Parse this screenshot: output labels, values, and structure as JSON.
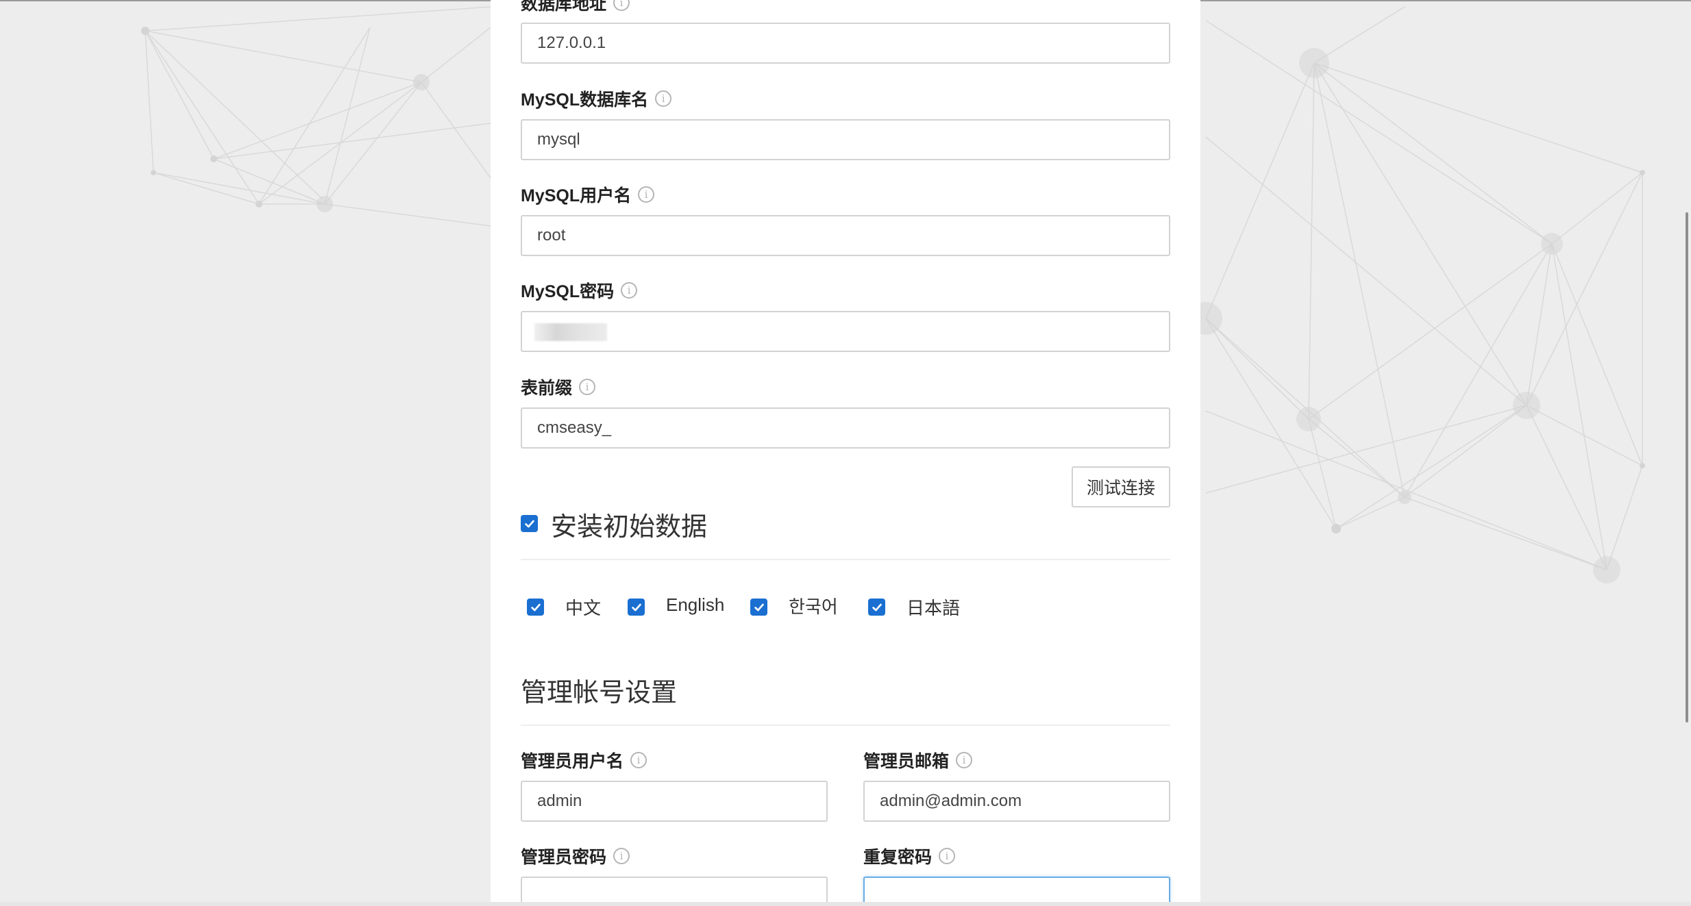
{
  "form": {
    "db_host": {
      "label": "数据库地址",
      "value": "127.0.0.1"
    },
    "db_name": {
      "label": "MySQL数据库名",
      "value": "mysql"
    },
    "db_user": {
      "label": "MySQL用户名",
      "value": "root"
    },
    "db_pass": {
      "label": "MySQL密码"
    },
    "table_prefix": {
      "label": "表前缀",
      "value": "cmseasy_"
    },
    "test_button": "测试连接",
    "install_initial_data": {
      "label": "安装初始数据",
      "checked": true
    },
    "languages": [
      {
        "label": "中文",
        "checked": true
      },
      {
        "label": "English",
        "checked": true
      },
      {
        "label": "한국어",
        "checked": true
      },
      {
        "label": "日本語",
        "checked": true
      }
    ]
  },
  "admin": {
    "section_title": "管理帐号设置",
    "username": {
      "label": "管理员用户名",
      "value": "admin"
    },
    "email": {
      "label": "管理员邮箱",
      "value": "admin@admin.com"
    },
    "password": {
      "label": "管理员密码",
      "value": "●●●●●●●●"
    },
    "repeat_password": {
      "label": "重复密码",
      "value": "●●●●●●●●"
    }
  },
  "icons": {
    "info": "info-circle-icon",
    "check": "checkmark-icon"
  },
  "colors": {
    "checkbox": "#1a6fd1",
    "page_background": "#ededed",
    "focus_border": "#6aaee6"
  }
}
